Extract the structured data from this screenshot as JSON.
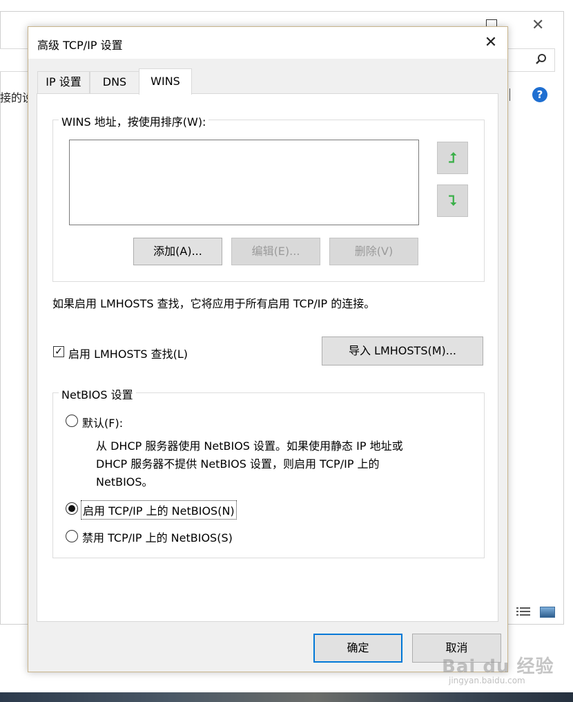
{
  "background_window": {
    "partial_label": "接的设",
    "help_glyph": "?"
  },
  "dialog": {
    "title": "高级 TCP/IP 设置",
    "close_glyph": "✕",
    "tabs": [
      {
        "label": "IP 设置"
      },
      {
        "label": "DNS"
      },
      {
        "label": "WINS",
        "selected": true
      }
    ],
    "wins": {
      "group_label": "WINS 地址，按使用排序(W):",
      "addresses": [],
      "up_glyph": "⮥",
      "down_glyph": "⮧",
      "add_label": "添加(A)...",
      "edit_label": "编辑(E)...",
      "delete_label": "删除(V)"
    },
    "lmhosts": {
      "info_text": "如果启用 LMHOSTS 查找，它将应用于所有启用 TCP/IP 的连接。",
      "checkbox_label": "启用 LMHOSTS 查找(L)",
      "checked": true,
      "check_glyph": "✓",
      "import_label": "导入 LMHOSTS(M)..."
    },
    "netbios": {
      "group_label": "NetBIOS 设置",
      "option_default": "默认(F):",
      "default_desc_line1": "从 DHCP 服务器使用 NetBIOS 设置。如果使用静态 IP 地址或",
      "default_desc_line2": "DHCP 服务器不提供 NetBIOS 设置，则启用 TCP/IP 上的",
      "default_desc_line3": "NetBIOS。",
      "option_enable": "启用 TCP/IP 上的 NetBIOS(N)",
      "option_disable": "禁用 TCP/IP 上的 NetBIOS(S)",
      "selected": "enable"
    },
    "ok_label": "确定",
    "cancel_label": "取消"
  },
  "watermark": {
    "brand": "Bai du 经验",
    "url": "jingyan.baidu.com"
  },
  "colors": {
    "accent": "#0078d7",
    "arrow_green": "#3cb04a"
  }
}
